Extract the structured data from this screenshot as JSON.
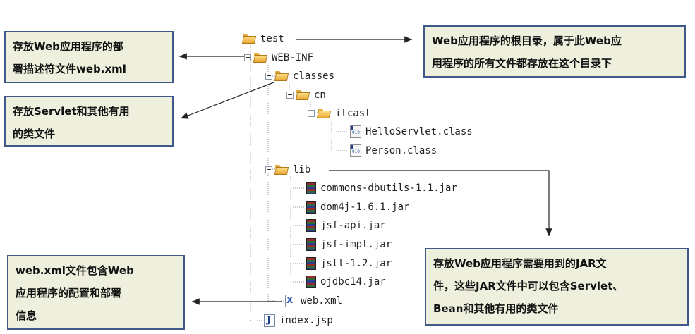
{
  "tree": {
    "root": "test",
    "web_inf": "WEB-INF",
    "classes": "classes",
    "cn": "cn",
    "itcast": "itcast",
    "hello_servlet": "HelloServlet.class",
    "person": "Person.class",
    "lib": "lib",
    "jars": [
      "commons-dbutils-1.1.jar",
      "dom4j-1.6.1.jar",
      "jsf-api.jar",
      "jsf-impl.jar",
      "jstl-1.2.jar",
      "ojdbc14.jar"
    ],
    "web_xml": "web.xml",
    "index_jsp": "index.jsp"
  },
  "annotations": {
    "deployment_descriptor": [
      "存放Web应用程序的部",
      "署描述符文件web.xml"
    ],
    "servlet_classes": [
      "存放Servlet和其他有用",
      "的类文件"
    ],
    "web_xml_info": [
      "web.xml文件包含Web",
      "应用程序的配置和部署",
      "信息"
    ],
    "root_dir": [
      "Web应用程序的根目录，属于此Web应",
      "用程序的所有文件都存放在这个目录下"
    ],
    "jar_files": [
      "存放Web应用程序需要用到的JAR文",
      "件，这些JAR文件中可以包含Servlet、",
      "Bean和其他有用的类文件"
    ]
  },
  "colors": {
    "box_fill": "#efefdd",
    "box_border": "#3f5a8a",
    "arrow": "#222222"
  }
}
